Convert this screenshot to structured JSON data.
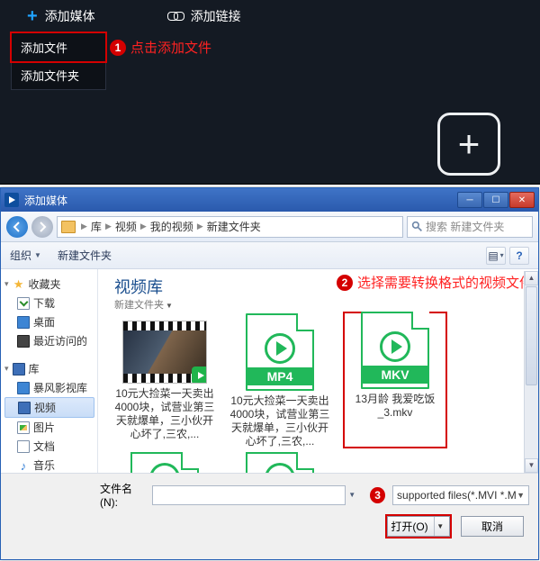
{
  "top": {
    "add_media": "添加媒体",
    "add_link": "添加链接",
    "menu": {
      "add_file": "添加文件",
      "add_folder": "添加文件夹"
    }
  },
  "annot": {
    "step1": "点击添加文件",
    "step2": "选择需要转换格式的视频文件"
  },
  "dialog": {
    "title": "添加媒体",
    "breadcrumb": {
      "lib": "库",
      "video": "视频",
      "my_video": "我的视频",
      "folder": "新建文件夹"
    },
    "search_ph": "搜索 新建文件夹",
    "toolbar": {
      "organize": "组织",
      "new_folder": "新建文件夹"
    },
    "sidebar": {
      "fav": "收藏夹",
      "download": "下载",
      "desktop": "桌面",
      "recent": "最近访问的",
      "lib": "库",
      "baofeng": "暴风影视库",
      "video": "视频",
      "pic": "图片",
      "doc": "文档",
      "music": "音乐"
    },
    "content": {
      "lib_title": "视频库",
      "lib_sub": "新建文件夹",
      "files": [
        {
          "name": "10元大捡菜一天卖出4000块，试营业第三天就爆单，三小伙开心坏了,三农,..."
        },
        {
          "fmt": "MP4",
          "name": "10元大捡菜一天卖出4000块，试营业第三天就爆单，三小伙开心坏了,三农,..."
        },
        {
          "fmt": "MKV",
          "name": "13月龄 我爱吃饭_3.mkv"
        }
      ]
    },
    "bottom": {
      "fname_label": "文件名(N):",
      "ftype": "supported files(*.MVI *.M",
      "open": "打开(O)",
      "cancel": "取消"
    }
  }
}
